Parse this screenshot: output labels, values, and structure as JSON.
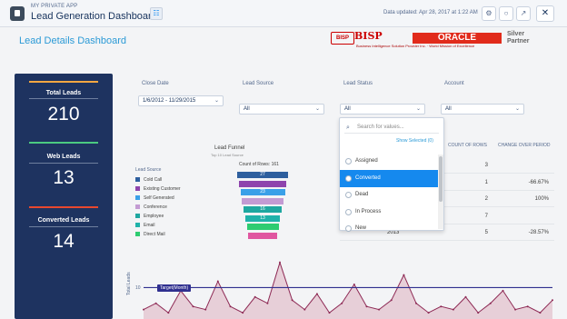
{
  "topbar": {
    "app_subtitle": "MY PRIVATE APP",
    "app_title": "Lead Generation Dashboard",
    "updated": "Data updated: Apr 28, 2017 at 1:22 AM"
  },
  "dashboard_title": "Lead Details Dashboard",
  "logo": {
    "mark": "BISP",
    "name": "BISP",
    "oracle": "ORACLE",
    "partner_line1": "Silver",
    "partner_line2": "Partner",
    "tagline": "Business Intelligence Solution Provider Inc. · World Mission of Excellence"
  },
  "kpis": [
    {
      "label": "Total Leads",
      "value": "210",
      "color": "#f4a742"
    },
    {
      "label": "Web Leads",
      "value": "13",
      "color": "#4bca81"
    },
    {
      "label": "Converted Leads",
      "value": "14",
      "color": "#e8482e"
    }
  ],
  "filters": {
    "close_date": {
      "label": "Close Date",
      "value": "1/6/2012 - 11/29/2015"
    },
    "lead_source": {
      "label": "Lead Source",
      "value": "All"
    },
    "lead_status": {
      "label": "Lead Status",
      "value": "All"
    },
    "account": {
      "label": "Account",
      "value": "All"
    }
  },
  "dropdown": {
    "search_placeholder": "Search for values...",
    "show_selected": "Show Selected (0)",
    "options": [
      "Assigned",
      "Converted",
      "Dead",
      "In Process",
      "New"
    ],
    "selected_index": 1
  },
  "funnel": {
    "title": "Lead Funnel",
    "subtitle": "Top 10 Lead Source",
    "count_label": "Count of Rows: 161",
    "legend_title": "Lead Source",
    "legend": [
      {
        "label": "Cold Call",
        "color": "#2e5f9e"
      },
      {
        "label": "Existing Customer",
        "color": "#8e44ad"
      },
      {
        "label": "Self Generated",
        "color": "#3aa0e8"
      },
      {
        "label": "Conference",
        "color": "#c39bd3"
      },
      {
        "label": "Employee",
        "color": "#1fa7a0"
      },
      {
        "label": "Email",
        "color": "#20b2aa"
      },
      {
        "label": "Direct Mail",
        "color": "#2ecc71"
      }
    ],
    "bars": [
      {
        "value": "27",
        "color": "#2e5f9e"
      },
      {
        "value": "",
        "color": "#8e44ad"
      },
      {
        "value": "23",
        "color": "#3aa0e8"
      },
      {
        "value": "",
        "color": "#c39bd3"
      },
      {
        "value": "16",
        "color": "#1fa7a0"
      },
      {
        "value": "13",
        "color": "#20b2aa"
      },
      {
        "value": "",
        "color": "#2ecc71"
      },
      {
        "value": "",
        "color": "#e056a0"
      }
    ]
  },
  "table": {
    "headers": [
      "COUNT OF ROWS",
      "CHANGE OVER PERIOD"
    ],
    "rows": [
      {
        "year": "",
        "count": "3",
        "change": ""
      },
      {
        "year": "",
        "count": "1",
        "change": "-66.67%"
      },
      {
        "year": "",
        "count": "2",
        "change": "100%"
      },
      {
        "year": "",
        "count": "7",
        "change": ""
      },
      {
        "year": "2013",
        "count": "5",
        "change": "-28.57%"
      }
    ]
  },
  "chart_data": {
    "type": "area",
    "ylabel": "Total Leads",
    "yticks": [
      "10"
    ],
    "target_label": "Target(Month)",
    "series": [
      {
        "values": [
          3,
          5,
          2,
          9,
          4,
          3,
          12,
          4,
          2,
          7,
          5,
          18,
          6,
          3,
          8,
          2,
          5,
          11,
          4,
          3,
          6,
          14,
          5,
          2,
          4,
          3,
          7,
          2,
          5,
          9,
          3,
          4,
          2,
          6
        ]
      }
    ],
    "target": 10,
    "ylim": [
      0,
      22
    ]
  },
  "icons": [
    "lock-icon",
    "hierarchy-icon",
    "alert-icon",
    "chat-icon",
    "share-icon",
    "close-icon"
  ]
}
